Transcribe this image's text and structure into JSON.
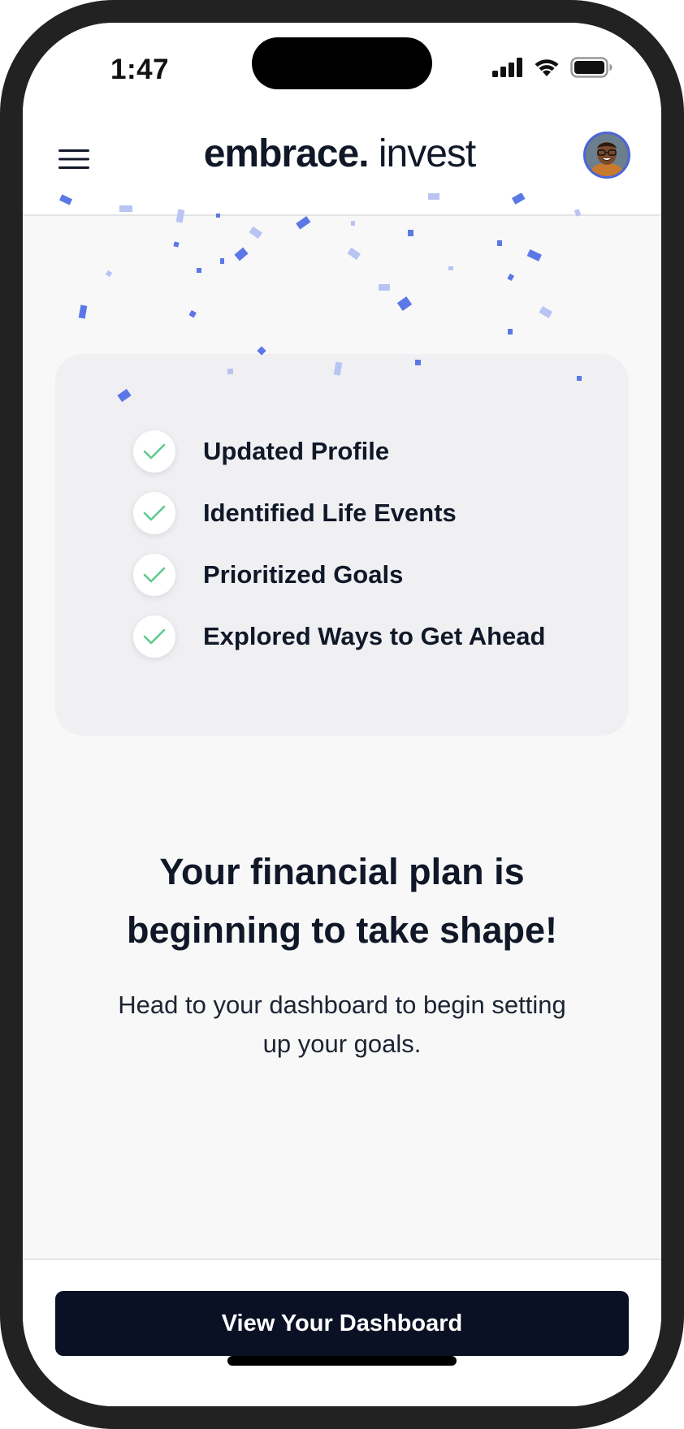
{
  "status_bar": {
    "time": "1:47",
    "icons": [
      "cellular-signal-icon",
      "wifi-icon",
      "battery-icon"
    ]
  },
  "header": {
    "menu_icon": "hamburger-menu-icon",
    "logo_primary": "embrace.",
    "logo_secondary": "invest",
    "avatar": "user-avatar"
  },
  "checklist": {
    "items": [
      {
        "label": "Updated Profile",
        "status": "complete",
        "icon": "checkmark-icon"
      },
      {
        "label": "Identified Life Events",
        "status": "complete",
        "icon": "checkmark-icon"
      },
      {
        "label": "Prioritized Goals",
        "status": "complete",
        "icon": "checkmark-icon"
      },
      {
        "label": "Explored Ways to Get Ahead",
        "status": "complete",
        "icon": "checkmark-icon"
      }
    ]
  },
  "message": {
    "headline": "Your financial plan is beginning to take shape!",
    "subtext": "Head to your dashboard to begin setting up your goals."
  },
  "footer": {
    "cta_label": "View Your Dashboard"
  },
  "colors": {
    "brand_dark": "#0a1124",
    "accent_blue": "#4a65d8",
    "check_green": "#5ecb8f",
    "confetti_blue": "#5b78e6",
    "confetti_light": "#b9c4f3"
  }
}
